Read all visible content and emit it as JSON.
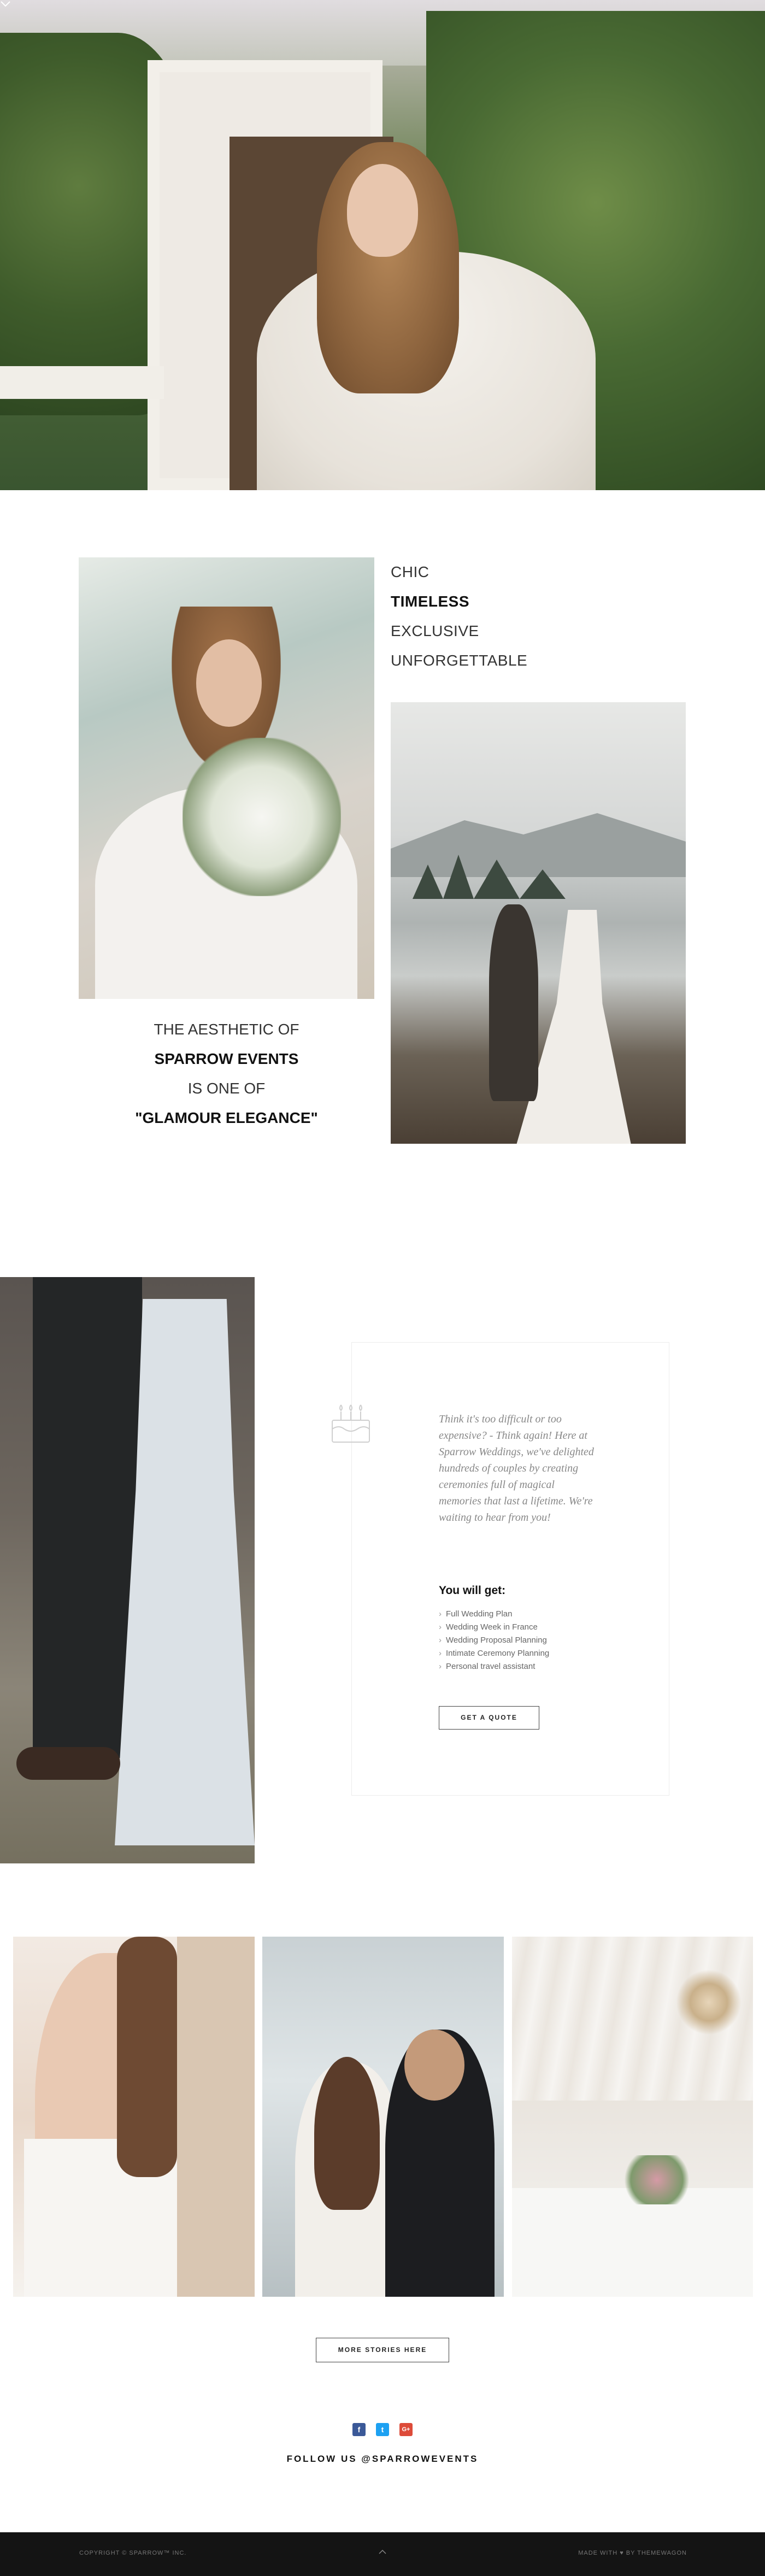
{
  "hero": {
    "scroll_icon": "chevron-down-icon"
  },
  "taglines": [
    "CHIC",
    "TIMELESS",
    "EXCLUSIVE",
    "UNFORGETTABLE"
  ],
  "aesthetic": {
    "line1": "THE AESTHETIC OF",
    "line2": "SPARROW EVENTS",
    "line3": "IS ONE OF",
    "line4": "\"GLAMOUR ELEGANCE\""
  },
  "offer": {
    "icon": "cake-icon",
    "quote": "Think it's too difficult or too expensive? - Think again! Here at Sparrow Weddings, we've delighted hundreds of couples by creating ceremonies full of magical memories that last a lifetime. We're waiting to hear from you!",
    "heading": "You will get:",
    "benefits": [
      "Full Wedding Plan",
      "Wedding Week in France",
      "Wedding Proposal Planning",
      "Intimate Ceremony Planning",
      "Personal travel assistant"
    ],
    "button": "GET A QUOTE"
  },
  "gallery": {
    "button": "MORE STORIES HERE"
  },
  "social": {
    "icons": [
      "facebook-icon",
      "twitter-icon",
      "google-plus-icon"
    ],
    "facebook_glyph": "f",
    "twitter_glyph": "t",
    "googleplus_glyph": "G+",
    "follow_text": "FOLLOW US @SPARROWEVENTS"
  },
  "footer": {
    "copyright": "COPYRIGHT © SPARROW™ INC.",
    "made_with": "MADE WITH ♥ BY THEMEWAGON",
    "to_top_icon": "chevron-up-icon"
  }
}
